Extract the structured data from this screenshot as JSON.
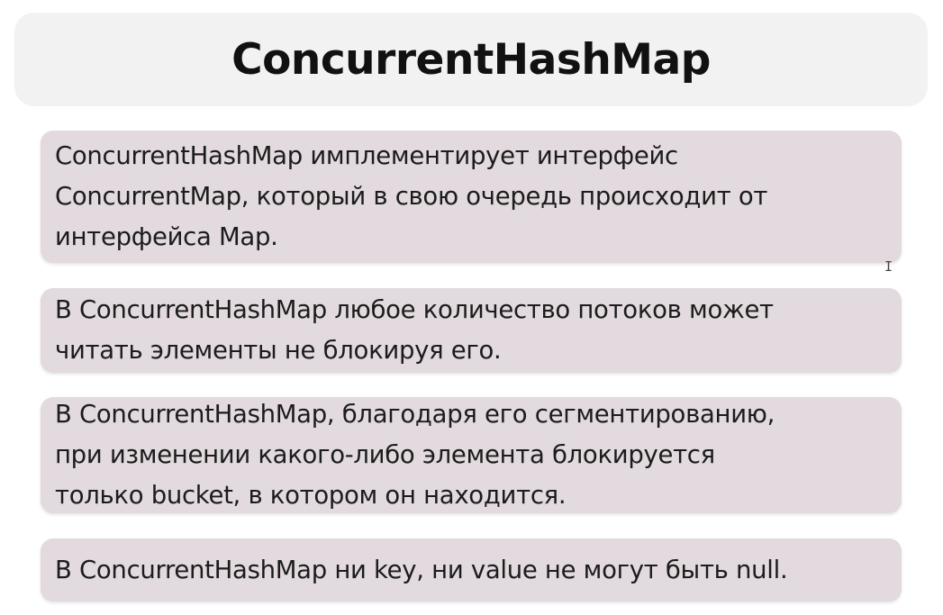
{
  "slide": {
    "title": "ConcurrentHashMap",
    "points": [
      {
        "lines": [
          "ConcurrentHashMap имплементирует интерфейс",
          "ConcurrentMap, который в свою очередь происходит от",
          "интерфейса Map."
        ]
      },
      {
        "lines": [
          "В ConcurrentHashMap любое количество потоков может",
          "читать элементы не блокируя его."
        ]
      },
      {
        "lines": [
          "В ConcurrentHashMap, благодаря его сегментированию,",
          "при изменении какого-либо элемента блокируется",
          "только bucket, в котором он находится."
        ]
      },
      {
        "lines": [
          "В ConcurrentHashMap ни key, ни value не могут быть null."
        ]
      }
    ]
  },
  "cursor": {
    "icon": "text-cursor-icon",
    "glyph": "I"
  }
}
